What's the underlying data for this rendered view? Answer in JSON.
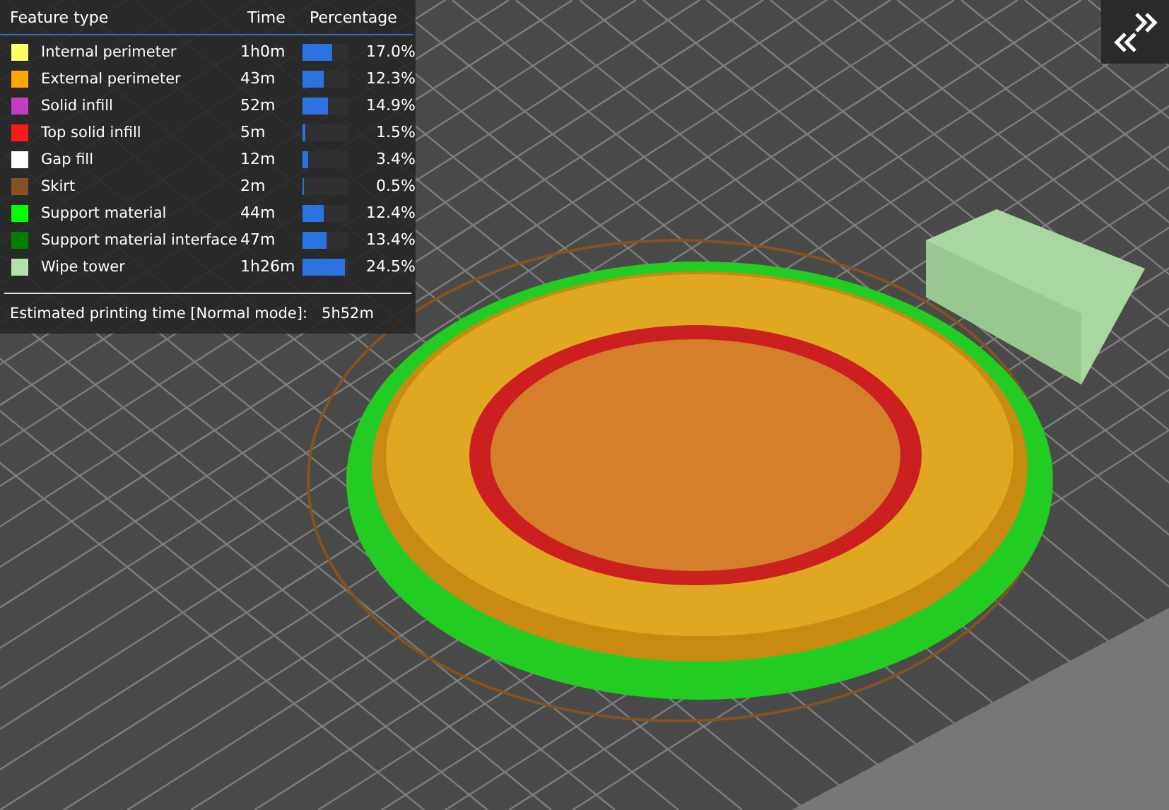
{
  "legend": {
    "columns": [
      "Feature type",
      "Time",
      "Percentage"
    ],
    "rows": [
      {
        "name": "Internal perimeter",
        "color": "#ffff68",
        "time": "1h0m",
        "level": 0.65,
        "percent": "17.0%"
      },
      {
        "name": "External perimeter",
        "color": "#ffa500",
        "time": "43m",
        "level": 0.47,
        "percent": "12.3%"
      },
      {
        "name": "Solid infill",
        "color": "#c43cc4",
        "time": "52m",
        "level": 0.57,
        "percent": "14.9%"
      },
      {
        "name": "Top solid infill",
        "color": "#ff1a1a",
        "time": "5m",
        "level": 0.06,
        "percent": "1.5%"
      },
      {
        "name": "Gap fill",
        "color": "#ffffff",
        "time": "12m",
        "level": 0.13,
        "percent": "3.4%"
      },
      {
        "name": "Skirt",
        "color": "#845321",
        "time": "2m",
        "level": 0.02,
        "percent": "0.5%"
      },
      {
        "name": "Support material",
        "color": "#00ff00",
        "time": "44m",
        "level": 0.48,
        "percent": "12.4%"
      },
      {
        "name": "Support material interface",
        "color": "#008000",
        "time": "47m",
        "level": 0.52,
        "percent": "13.4%"
      },
      {
        "name": "Wipe tower",
        "color": "#b3e3ab",
        "time": "1h26m",
        "level": 0.94,
        "percent": "24.5%"
      }
    ],
    "estimate_label": "Estimated printing time [Normal mode]:",
    "estimate_value": "5h52m"
  }
}
